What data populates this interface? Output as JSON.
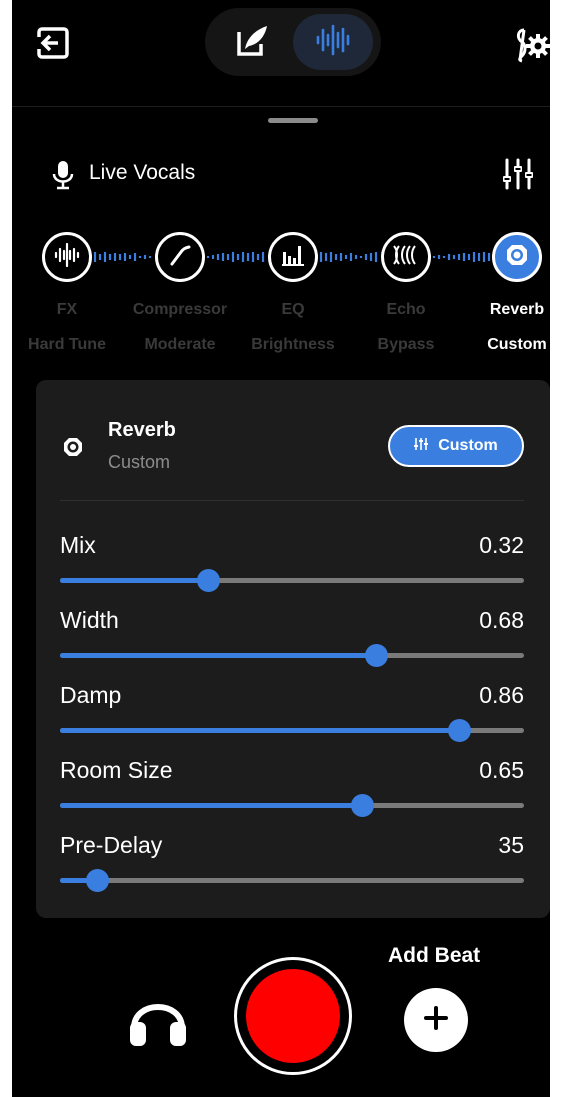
{
  "header": {
    "exit_icon": "exit-icon",
    "modes": [
      {
        "name": "lyrics",
        "icon": "feather-pen-icon",
        "active": false
      },
      {
        "name": "vocal-fx",
        "icon": "waveform-icon",
        "active": true
      }
    ],
    "settings_icon": "music-settings-icon"
  },
  "chain": {
    "source_label": "Live Vocals",
    "source_icon": "microphone-icon",
    "mixer_icon": "sliders-icon",
    "nodes": [
      {
        "name": "FX",
        "setting": "Hard Tune",
        "icon": "waveform-icon",
        "active": false
      },
      {
        "name": "Compressor",
        "setting": "Moderate",
        "icon": "curve-icon",
        "active": false
      },
      {
        "name": "EQ",
        "setting": "Brightness",
        "icon": "eq-bars-icon",
        "active": false
      },
      {
        "name": "Echo",
        "setting": "Bypass",
        "icon": "echo-icon",
        "active": false
      },
      {
        "name": "Reverb",
        "setting": "Custom",
        "icon": "reverb-icon",
        "active": true
      }
    ]
  },
  "panel": {
    "title": "Reverb",
    "subtitle": "Custom",
    "icon": "reverb-icon",
    "preset_button": "Custom",
    "params": [
      {
        "name": "Mix",
        "value": "0.32",
        "fraction": 0.32
      },
      {
        "name": "Width",
        "value": "0.68",
        "fraction": 0.68
      },
      {
        "name": "Damp",
        "value": "0.86",
        "fraction": 0.86
      },
      {
        "name": "Room Size",
        "value": "0.65",
        "fraction": 0.65
      },
      {
        "name": "Pre-Delay",
        "value": "35",
        "fraction": 0.08
      }
    ]
  },
  "bottom": {
    "monitor_icon": "headphones-icon",
    "record_color": "#ff0000",
    "add_beat_label": "Add Beat",
    "add_beat_icon": "plus-icon"
  },
  "colors": {
    "accent": "#3a7fe0",
    "background": "#000000",
    "panel": "#1c1c1c",
    "inactive_text": "#3a3a3a"
  }
}
